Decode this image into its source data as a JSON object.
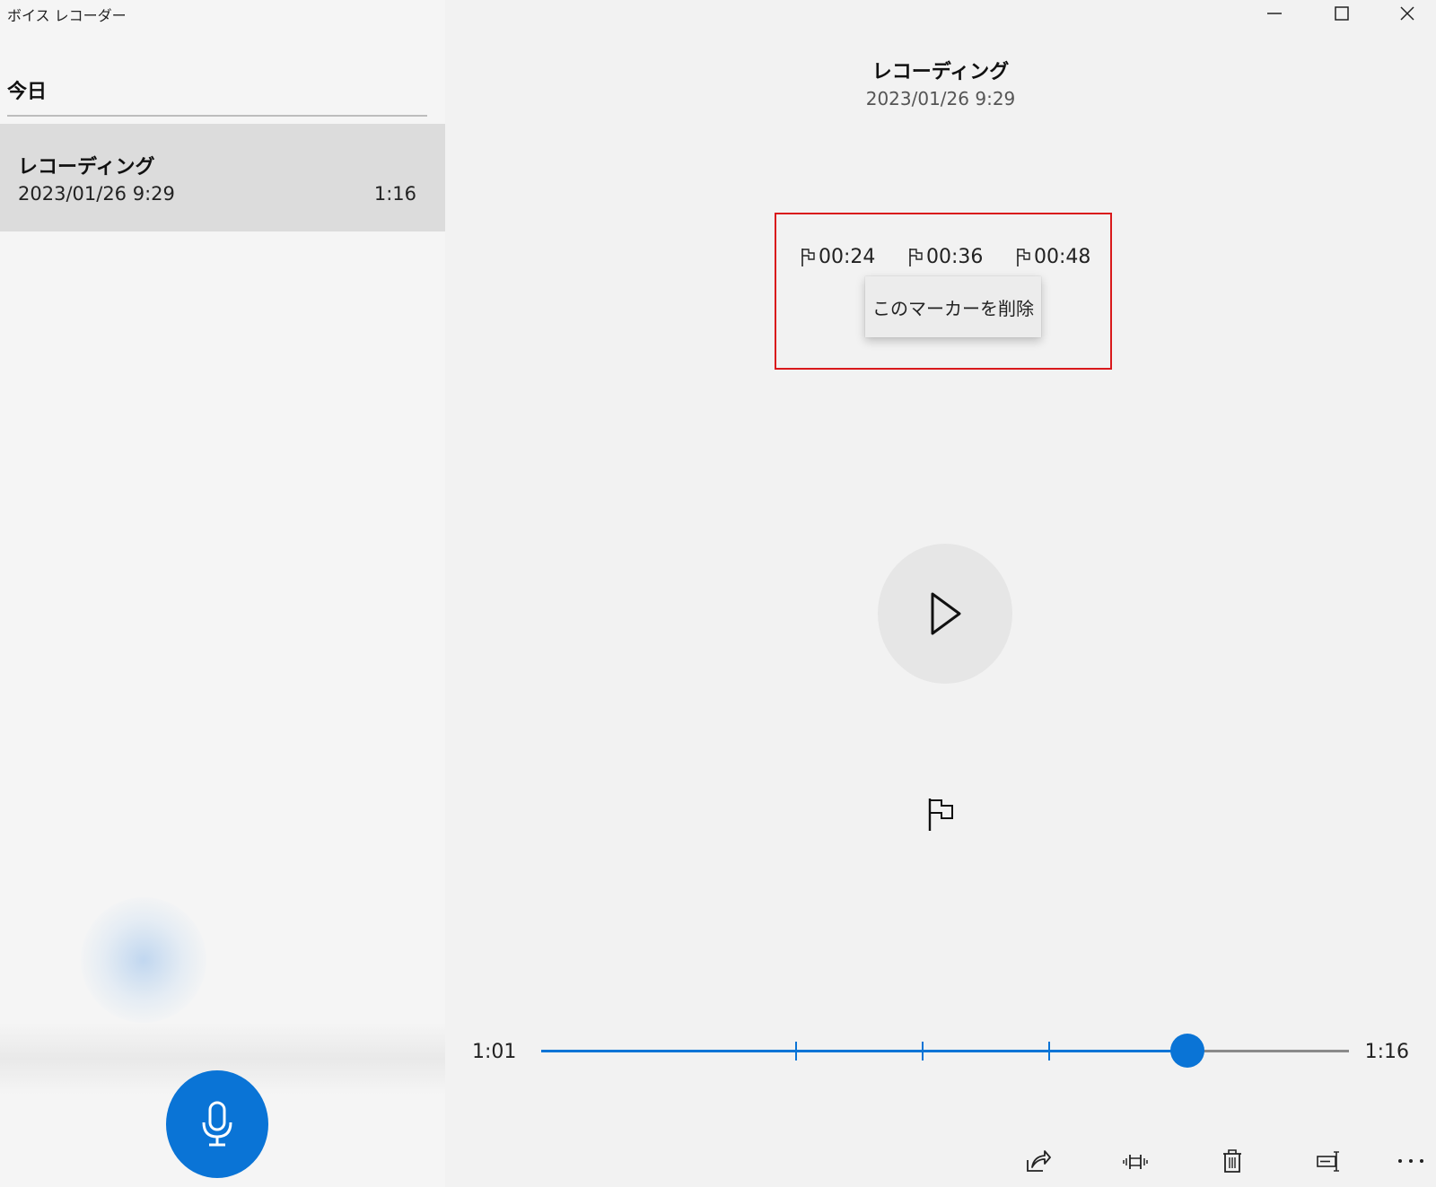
{
  "app": {
    "title": "ボイス レコーダー"
  },
  "sidebar": {
    "section_header": "今日",
    "items": [
      {
        "title": "レコーディング",
        "date": "2023/01/26 9:29",
        "duration": "1:16"
      }
    ]
  },
  "recording": {
    "title": "レコーディング",
    "date": "2023/01/26 9:29"
  },
  "markers": [
    {
      "time": "00:24"
    },
    {
      "time": "00:36"
    },
    {
      "time": "00:48"
    }
  ],
  "context_menu": {
    "delete_marker": "このマーカーを削除"
  },
  "playback": {
    "current_time": "1:01",
    "total_time": "1:16",
    "progress_fraction": 0.8
  },
  "toolbar": {
    "icons": [
      "share-icon",
      "trim-icon",
      "delete-icon",
      "rename-icon",
      "more-icon"
    ]
  },
  "colors": {
    "accent": "#0a74d6",
    "highlight_box": "#d9191c"
  }
}
